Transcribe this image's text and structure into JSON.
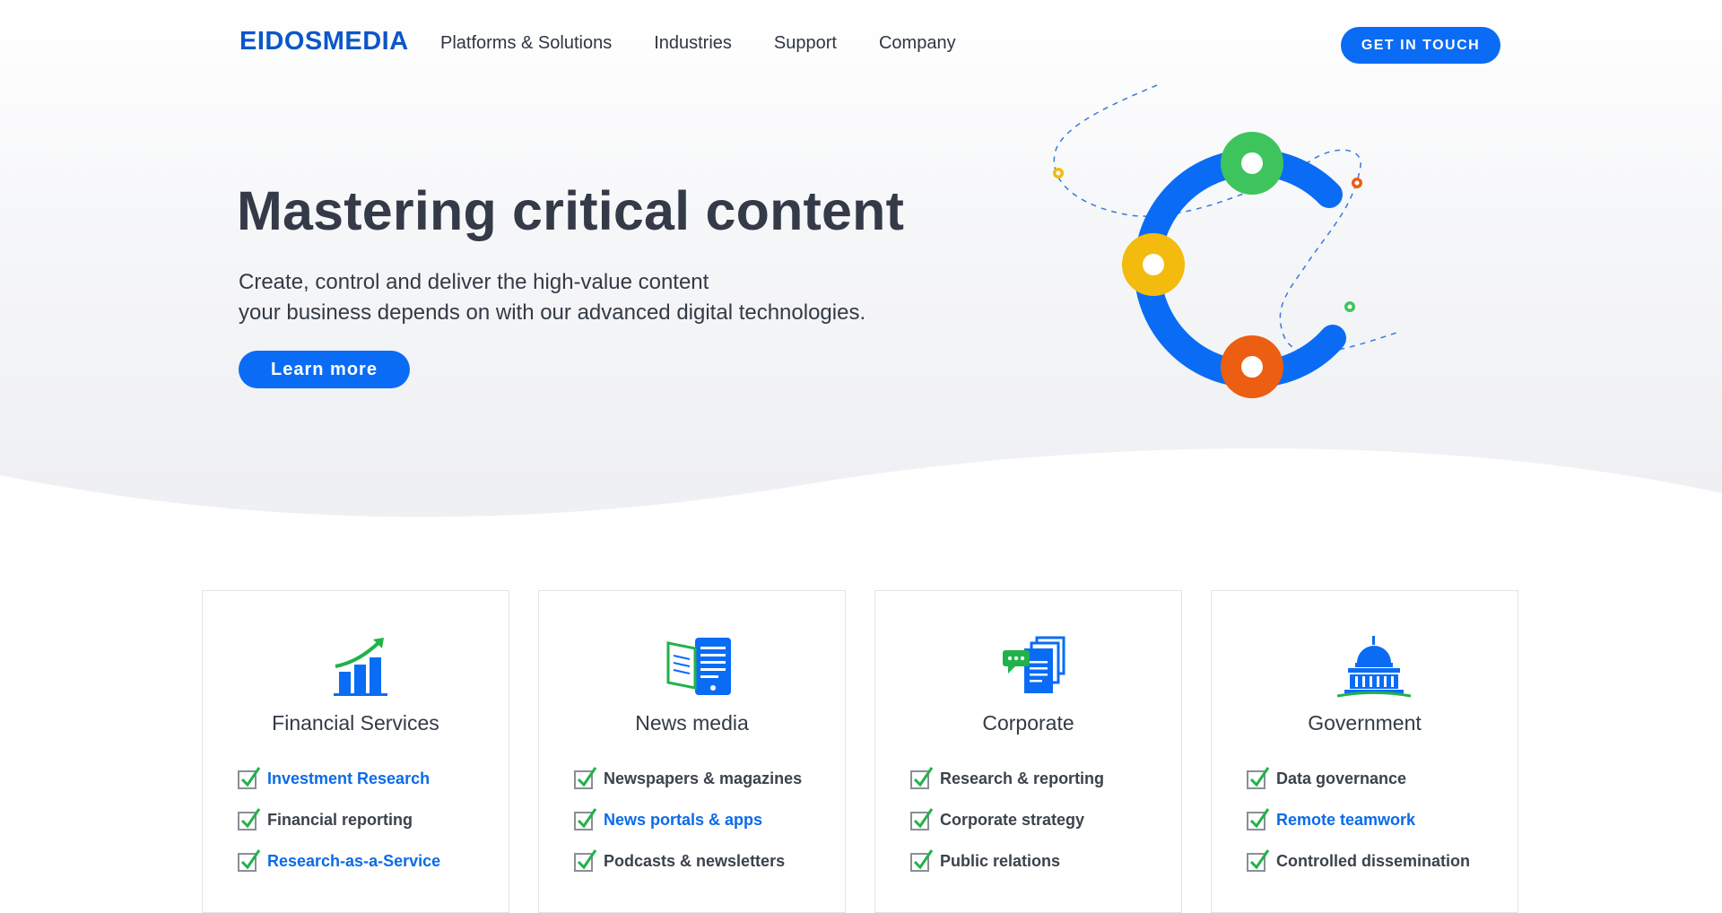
{
  "header": {
    "logo": "EIDOSMEDIA",
    "nav": [
      "Platforms & Solutions",
      "Industries",
      "Support",
      "Company"
    ],
    "cta": "GET IN TOUCH"
  },
  "hero": {
    "title": "Mastering critical content",
    "subtitle_line1": "Create, control and deliver the high-value content",
    "subtitle_line2": "your business depends on with our advanced digital technologies.",
    "button": "Learn more"
  },
  "colors": {
    "primary": "#0a6cf5",
    "logo": "#0b57c8",
    "text": "#333a46",
    "link": "#0b6be8",
    "check": "#21b24a",
    "ring_green": "#3ec45c",
    "ring_yellow": "#f2bb0d",
    "ring_orange": "#ec5e12"
  },
  "cards": [
    {
      "title": "Financial Services",
      "icon": "growth-chart-icon",
      "items": [
        {
          "label": "Investment Research",
          "link": true
        },
        {
          "label": "Financial reporting",
          "link": false
        },
        {
          "label": "Research-as-a-Service",
          "link": true
        }
      ]
    },
    {
      "title": "News media",
      "icon": "news-devices-icon",
      "items": [
        {
          "label": "Newspapers & magazines",
          "link": false
        },
        {
          "label": "News portals & apps",
          "link": true
        },
        {
          "label": "Podcasts & newsletters",
          "link": false
        }
      ]
    },
    {
      "title": "Corporate",
      "icon": "documents-chat-icon",
      "items": [
        {
          "label": "Research & reporting",
          "link": false
        },
        {
          "label": "Corporate strategy",
          "link": false
        },
        {
          "label": "Public relations",
          "link": false
        }
      ]
    },
    {
      "title": "Government",
      "icon": "capitol-building-icon",
      "items": [
        {
          "label": "Data governance",
          "link": false
        },
        {
          "label": "Remote teamwork",
          "link": true
        },
        {
          "label": "Controlled dissemination",
          "link": false
        }
      ]
    }
  ]
}
